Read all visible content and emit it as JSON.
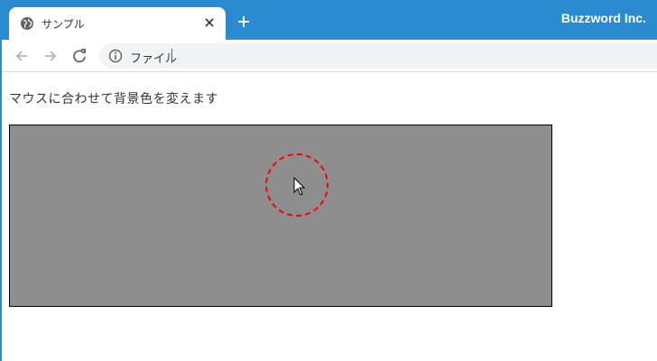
{
  "browser": {
    "tab": {
      "title": "サンプル",
      "close_glyph": "✕",
      "favicon": "globe-icon"
    },
    "new_tab_glyph": "+",
    "brand": "Buzzword Inc.",
    "address": {
      "text": "ファイル"
    }
  },
  "page": {
    "heading": "マウスに合わせて背景色を変えます"
  },
  "colors": {
    "titlebar": "#2a8bd1",
    "box_background": "#8e8e8e",
    "ring": "#ff0000"
  }
}
